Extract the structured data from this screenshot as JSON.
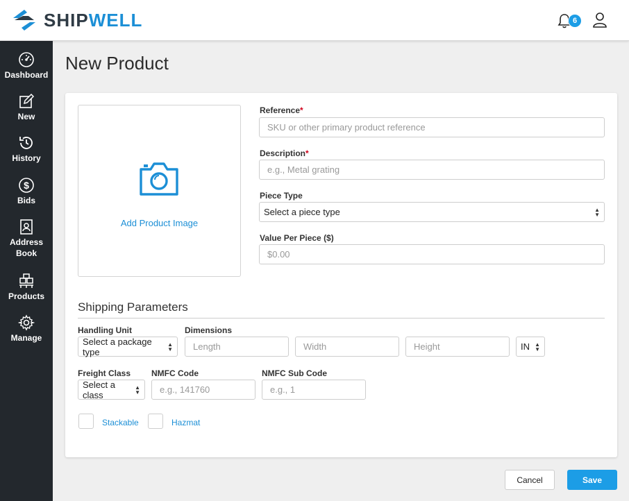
{
  "app": {
    "brand_part1": "SHIP",
    "brand_part2": "WELL",
    "notification_count": "6",
    "colors": {
      "brand_blue": "#1c8fd6",
      "sidebar_bg": "#23282d",
      "primary_button": "#1c9de6"
    }
  },
  "sidebar": {
    "items": [
      {
        "label": "Dashboard",
        "icon": "dashboard-gauge-icon"
      },
      {
        "label": "New",
        "icon": "pencil-square-icon"
      },
      {
        "label": "History",
        "icon": "history-clock-icon"
      },
      {
        "label": "Bids",
        "icon": "dollar-circle-icon"
      },
      {
        "label_line1": "Address",
        "label_line2": "Book",
        "icon": "address-book-icon"
      },
      {
        "label": "Products",
        "icon": "boxes-icon"
      },
      {
        "label": "Manage",
        "icon": "gear-icon"
      }
    ]
  },
  "page": {
    "title": "New Product"
  },
  "product_image": {
    "label": "Add Product Image"
  },
  "form": {
    "reference": {
      "label": "Reference",
      "required_mark": "*",
      "placeholder": "SKU or other primary product reference"
    },
    "description": {
      "label": "Description",
      "required_mark": "*",
      "placeholder": "e.g., Metal grating"
    },
    "piece_type": {
      "label": "Piece Type",
      "value": "Select a piece type"
    },
    "value_per_piece": {
      "label": "Value Per Piece ($)",
      "placeholder": "$0.00"
    }
  },
  "shipping": {
    "title": "Shipping Parameters",
    "handling_unit": {
      "label": "Handling Unit",
      "value": "Select a package type"
    },
    "dimensions": {
      "label": "Dimensions",
      "length_placeholder": "Length",
      "width_placeholder": "Width",
      "height_placeholder": "Height",
      "unit_value": "IN"
    },
    "freight_class": {
      "label": "Freight Class",
      "value": "Select a class"
    },
    "nmfc_code": {
      "label": "NMFC Code",
      "placeholder": "e.g., 141760"
    },
    "nmfc_sub_code": {
      "label": "NMFC Sub Code",
      "placeholder": "e.g., 1"
    },
    "stackable_label": "Stackable",
    "hazmat_label": "Hazmat"
  },
  "actions": {
    "cancel_label": "Cancel",
    "save_label": "Save"
  }
}
